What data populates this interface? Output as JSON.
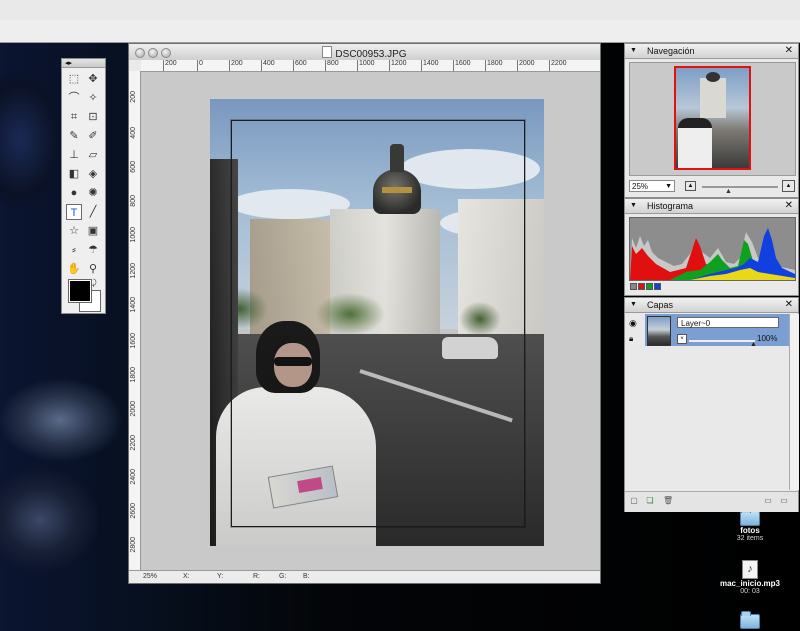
{
  "document": {
    "title": "DSC00953.JPG",
    "ruler_top": [
      "200",
      "0",
      "200",
      "400",
      "600",
      "800",
      "1000",
      "1200",
      "1400",
      "1600",
      "1800",
      "2000",
      "2200"
    ],
    "ruler_left": [
      "200",
      "400",
      "600",
      "800",
      "1000",
      "1200",
      "1400",
      "1600",
      "1800",
      "2000",
      "2200",
      "2400",
      "2600",
      "2800"
    ],
    "status": {
      "zoom": "25%",
      "x_label": "X:",
      "y_label": "Y:",
      "r_label": "R:",
      "g_label": "G:",
      "b_label": "B:"
    }
  },
  "tools_panel": {
    "grip": "◂▸",
    "icons": [
      "marquee-rect-icon",
      "move-icon",
      "lasso-icon",
      "magic-wand-icon",
      "crop-icon",
      "transform-icon",
      "pencil-icon",
      "brush-icon",
      "stamp-icon",
      "eraser-icon",
      "gradient-icon",
      "bucket-icon",
      "blur-icon",
      "sponge-icon",
      "text-icon",
      "line-icon",
      "shape-icon",
      "rect-shape-icon",
      "eyedropper-icon",
      "smudge-icon",
      "hand-icon",
      "zoom-icon"
    ],
    "foreground": "#000000",
    "background": "#ffffff"
  },
  "navigation": {
    "title": "Navegación",
    "zoom_value": "25%"
  },
  "histogram": {
    "title": "Histograma",
    "channels": [
      "#888888",
      "#e01010",
      "#10a020",
      "#1040e0"
    ]
  },
  "layers": {
    "title": "Capas",
    "layer_name": "Layer~0",
    "opacity": "100%",
    "opacity_fraction": 1.0
  },
  "desktop": {
    "icons": [
      {
        "name": "fotos",
        "sub": "32 items",
        "type": "folder-icon"
      },
      {
        "name": "mac_inicio.mp3",
        "sub": "00: 03",
        "type": "music-file-icon"
      },
      {
        "name": "",
        "sub": "",
        "type": "folder-icon"
      }
    ]
  },
  "colors": {
    "selection_frame": "#e11111",
    "layer_selected": "#7b9fd3"
  }
}
